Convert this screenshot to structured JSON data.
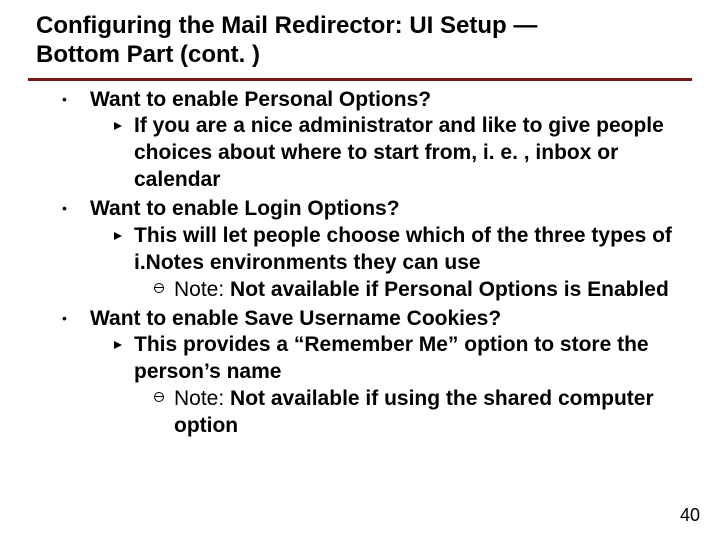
{
  "title_line1": "Configuring the Mail Redirector: UI Setup —",
  "title_line2": "Bottom Part (cont. )",
  "bullets": [
    {
      "head": "Want to enable Personal Options?",
      "subs": [
        {
          "text": "If you are a nice administrator and like to give people choices about where to start from, i. e. , inbox or calendar",
          "notes": []
        }
      ]
    },
    {
      "head": "Want to enable Login Options?",
      "subs": [
        {
          "text": "This will let people choose which of the three types of i.Notes environments they can use",
          "notes": [
            {
              "label": "Note: ",
              "body": "Not available if Personal Options is Enabled"
            }
          ]
        }
      ]
    },
    {
      "head": "Want to enable Save Username Cookies?",
      "subs": [
        {
          "text": "This provides a “Remember Me” option to store the person’s name",
          "notes": [
            {
              "label": "Note: ",
              "body": "Not available if using the shared computer option"
            }
          ]
        }
      ]
    }
  ],
  "page_number": "40"
}
